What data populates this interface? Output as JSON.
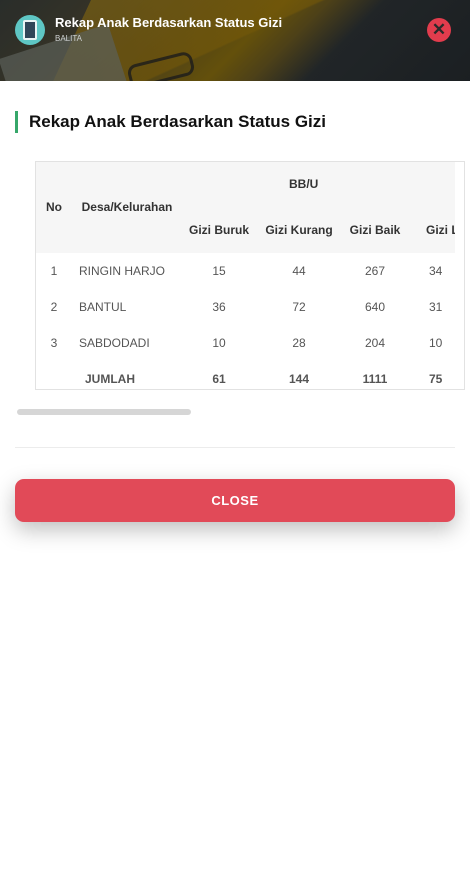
{
  "header": {
    "title": "Rekap Anak Berdasarkan Status Gizi",
    "subtitle": "BALITA"
  },
  "section_title": "Rekap Anak Berdasarkan Status Gizi",
  "table": {
    "group_header": "BB/U",
    "col_no": "No",
    "col_desa": "Desa/Kelurahan",
    "sub_headers": [
      "Gizi Buruk",
      "Gizi Kurang",
      "Gizi Baik",
      "Gizi Le"
    ],
    "rows": [
      {
        "no": "1",
        "desa": "RINGIN HARJO",
        "values": [
          "15",
          "44",
          "267",
          "34"
        ]
      },
      {
        "no": "2",
        "desa": "BANTUL",
        "values": [
          "36",
          "72",
          "640",
          "31"
        ]
      },
      {
        "no": "3",
        "desa": "SABDODADI",
        "values": [
          "10",
          "28",
          "204",
          "10"
        ]
      }
    ],
    "total": {
      "label": "JUMLAH",
      "values": [
        "61",
        "144",
        "1111",
        "75"
      ]
    }
  },
  "close_button": "CLOSE",
  "colors": {
    "accent_green": "#36a76a",
    "close_red": "#e14a58"
  }
}
